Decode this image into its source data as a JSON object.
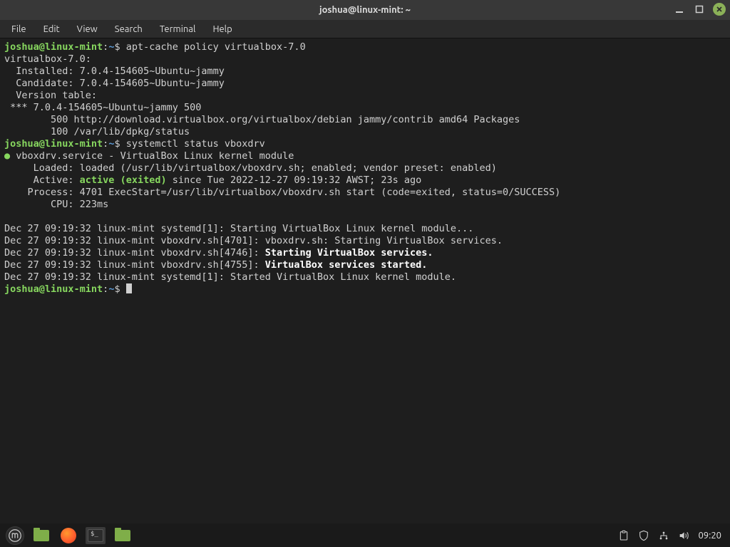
{
  "titlebar": {
    "title": "joshua@linux-mint: ~"
  },
  "menu": {
    "file": "File",
    "edit": "Edit",
    "view": "View",
    "search": "Search",
    "terminal": "Terminal",
    "help": "Help"
  },
  "prompt": {
    "userhost": "joshua@linux-mint",
    "sep": ":",
    "path": "~",
    "sigil": "$"
  },
  "cmd1": "apt-cache policy virtualbox-7.0",
  "apt": {
    "l1": "virtualbox-7.0:",
    "l2": "  Installed: 7.0.4-154605~Ubuntu~jammy",
    "l3": "  Candidate: 7.0.4-154605~Ubuntu~jammy",
    "l4": "  Version table:",
    "l5": " *** 7.0.4-154605~Ubuntu~jammy 500",
    "l6": "        500 http://download.virtualbox.org/virtualbox/debian jammy/contrib amd64 Packages",
    "l7": "        100 /var/lib/dpkg/status"
  },
  "cmd2": "systemctl status vboxdrv",
  "sys": {
    "bullet": "●",
    "head": " vboxdrv.service - VirtualBox Linux kernel module",
    "loaded": "     Loaded: loaded (/usr/lib/virtualbox/vboxdrv.sh; enabled; vendor preset: enabled)",
    "active_lbl": "     Active: ",
    "active_val": "active (exited)",
    "active_rest": " since Tue 2022-12-27 09:19:32 AWST; 23s ago",
    "process": "    Process: 4701 ExecStart=/usr/lib/virtualbox/vboxdrv.sh start (code=exited, status=0/SUCCESS)",
    "cpu": "        CPU: 223ms",
    "j1": "Dec 27 09:19:32 linux-mint systemd[1]: Starting VirtualBox Linux kernel module...",
    "j2": "Dec 27 09:19:32 linux-mint vboxdrv.sh[4701]: vboxdrv.sh: Starting VirtualBox services.",
    "j3a": "Dec 27 09:19:32 linux-mint vboxdrv.sh[4746]: ",
    "j3b": "Starting VirtualBox services.",
    "j4a": "Dec 27 09:19:32 linux-mint vboxdrv.sh[4755]: ",
    "j4b": "VirtualBox services started.",
    "j5": "Dec 27 09:19:32 linux-mint systemd[1]: Started VirtualBox Linux kernel module."
  },
  "panel": {
    "clock": "09:20"
  }
}
